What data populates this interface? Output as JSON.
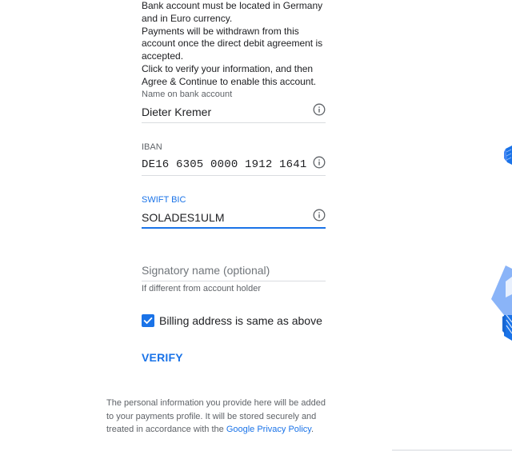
{
  "intro": {
    "line1": "Bank account must be located in Germany and in Euro currency.",
    "line2": "Payments will be withdrawn from this account once the direct debit agreement is accepted.",
    "line3": "Click to verify your information, and then Agree & Continue to enable this account."
  },
  "fields": {
    "name": {
      "label": "Name on bank account",
      "value": "Dieter Kremer",
      "icon": "info-icon"
    },
    "iban": {
      "label": "IBAN",
      "value": "DE16 6305 0000 1912 1641",
      "icon": "info-icon"
    },
    "swift": {
      "label": "SWIFT BIC",
      "value": "SOLADES1ULM",
      "icon": "info-icon"
    },
    "signatory": {
      "placeholder": "Signatory name (optional)",
      "helper": "If different from account holder"
    }
  },
  "billing": {
    "label": "Billing address is same as above",
    "checked": true
  },
  "actions": {
    "verify_label": "VERIFY"
  },
  "footer": {
    "text_before": "The personal information you provide here will be added to your payments profile. It will be stored securely and treated in accordance with the ",
    "link_text": "Google Privacy Policy",
    "text_after": "."
  },
  "colors": {
    "accent": "#1a73e8",
    "text": "#202124",
    "muted": "#5f6368",
    "divider": "#dadce0"
  }
}
